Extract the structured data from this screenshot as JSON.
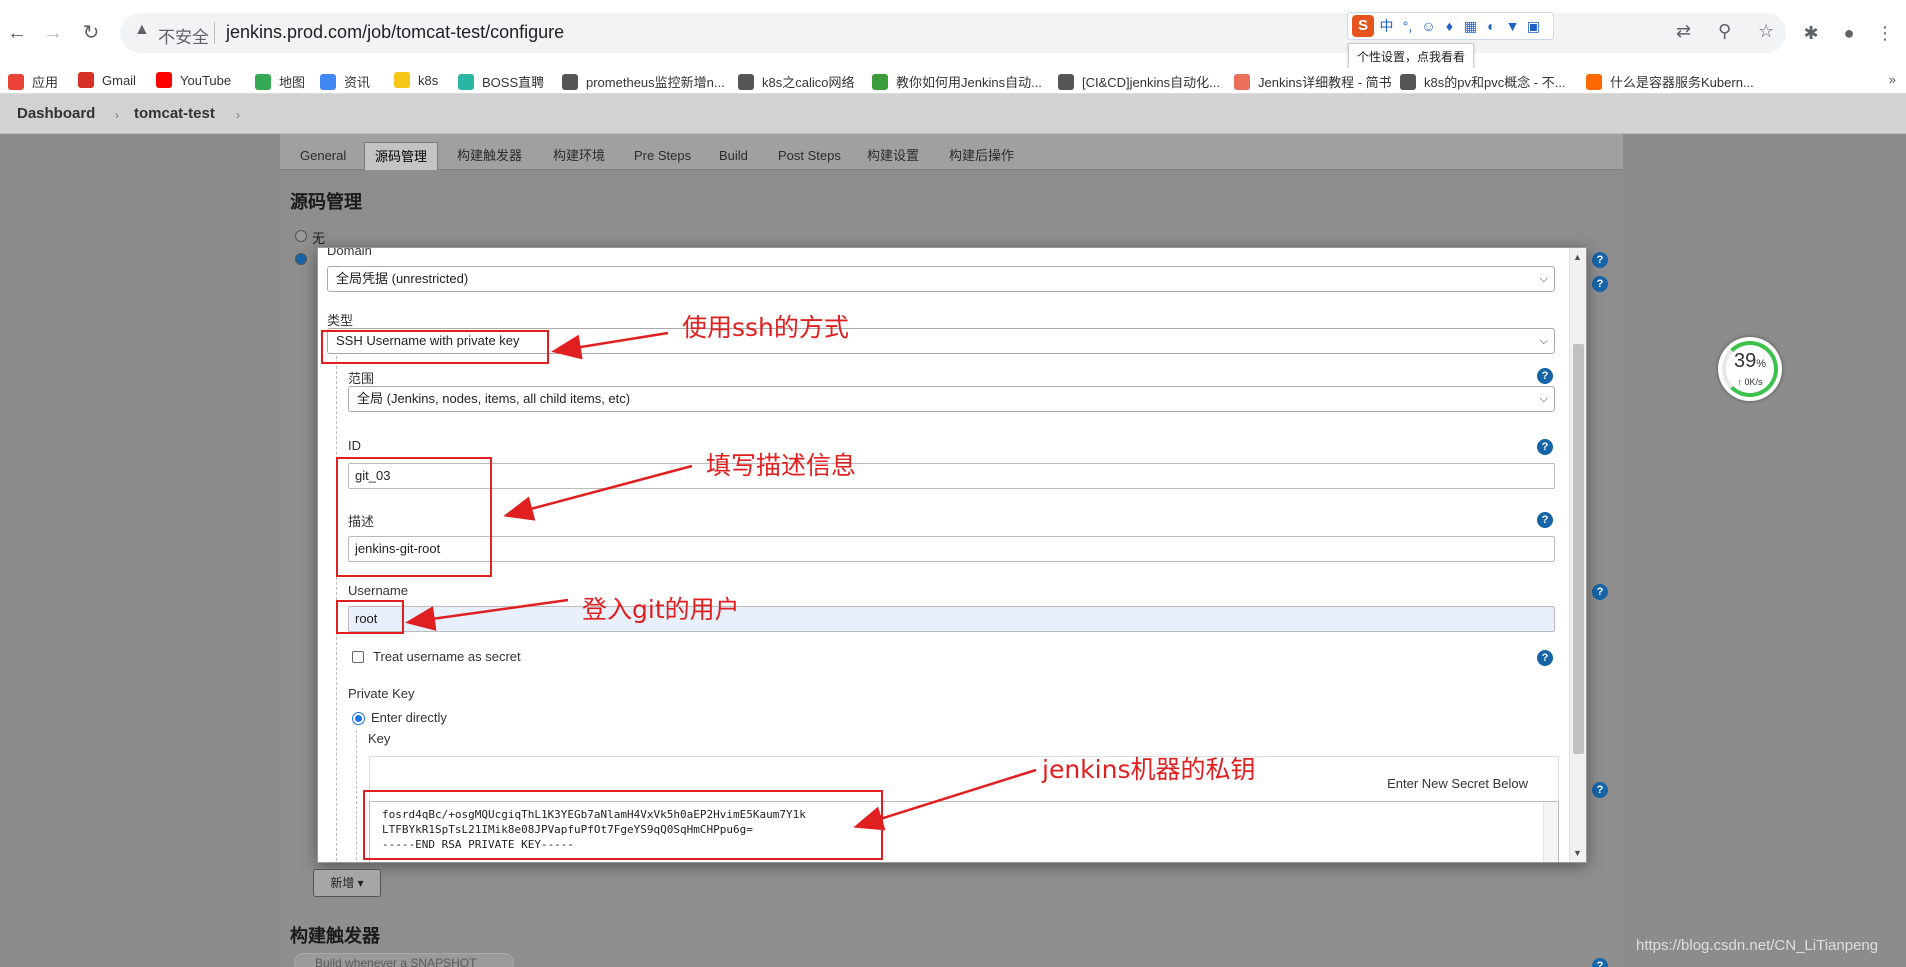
{
  "browser": {
    "security_label": "不安全",
    "url": "jenkins.prod.com/job/tomcat-test/configure",
    "ime_tooltip": "个性设置，点我看看",
    "ime_mode": "中"
  },
  "bookmarks": [
    {
      "label": "应用",
      "color": "#e94235"
    },
    {
      "label": "Gmail",
      "color": "#d93025"
    },
    {
      "label": "YouTube",
      "color": "#ff0000"
    },
    {
      "label": "地图",
      "color": "#34a853"
    },
    {
      "label": "资讯",
      "color": "#4285f4"
    },
    {
      "label": "k8s",
      "color": "#f5c518"
    },
    {
      "label": "BOSS直聘",
      "color": "#2bb6a3"
    },
    {
      "label": "prometheus监控新增n...",
      "color": "#555555"
    },
    {
      "label": "k8s之calico网络",
      "color": "#555555"
    },
    {
      "label": "教你如何用Jenkins自动...",
      "color": "#3a9c3a"
    },
    {
      "label": "[CI&CD]jenkins自动化...",
      "color": "#555555"
    },
    {
      "label": "Jenkins详细教程 - 简书",
      "color": "#ea6f5a"
    },
    {
      "label": "k8s的pv和pvc概念 - 不...",
      "color": "#555555"
    },
    {
      "label": "什么是容器服务Kubern...",
      "color": "#ff6a00"
    }
  ],
  "breadcrumb": {
    "root": "Dashboard",
    "job": "tomcat-test"
  },
  "tabs": [
    "General",
    "源码管理",
    "构建触发器",
    "构建环境",
    "Pre Steps",
    "Build",
    "Post Steps",
    "构建设置",
    "构建后操作"
  ],
  "scm": {
    "title": "源码管理",
    "option_none": "无"
  },
  "dialog": {
    "domain_label": "Domain",
    "domain_value": "全局凭据 (unrestricted)",
    "kind_label": "类型",
    "kind_value": "SSH Username with private key",
    "scope_label": "范围",
    "scope_value": "全局 (Jenkins, nodes, items, all child items, etc)",
    "id_label": "ID",
    "id_value": "git_03",
    "desc_label": "描述",
    "desc_value": "jenkins-git-root",
    "username_label": "Username",
    "username_value": "root",
    "treat_secret_label": "Treat username as secret",
    "private_key_label": "Private Key",
    "enter_directly_label": "Enter directly",
    "key_label": "Key",
    "enter_new_secret": "Enter New Secret Below",
    "key_lines": [
      "fosrd4qBc/+osgMQUcgiqThL1K3YEGb7aNlamH4VxVk5h0aEP2HvimE5Kaum7Y1k",
      "LTFBYkR1SpTsL21IMik8e08JPVapfuPfOt7FgeYS9qQ0SqHmCHPpu6g=",
      "-----END RSA PRIVATE KEY-----"
    ]
  },
  "annotations": {
    "ssh": "使用ssh的方式",
    "desc": "填写描述信息",
    "user": "登入git的用户",
    "key": "jenkins机器的私钥"
  },
  "add_button": "新增",
  "next_section": "构建触发器",
  "ghost_text": "Build whenever a SNAPSHOT dependency is built",
  "speed": {
    "percent": "39",
    "unit": "%",
    "rate": "0K/s"
  },
  "watermark": "https://blog.csdn.net/CN_LiTianpeng"
}
